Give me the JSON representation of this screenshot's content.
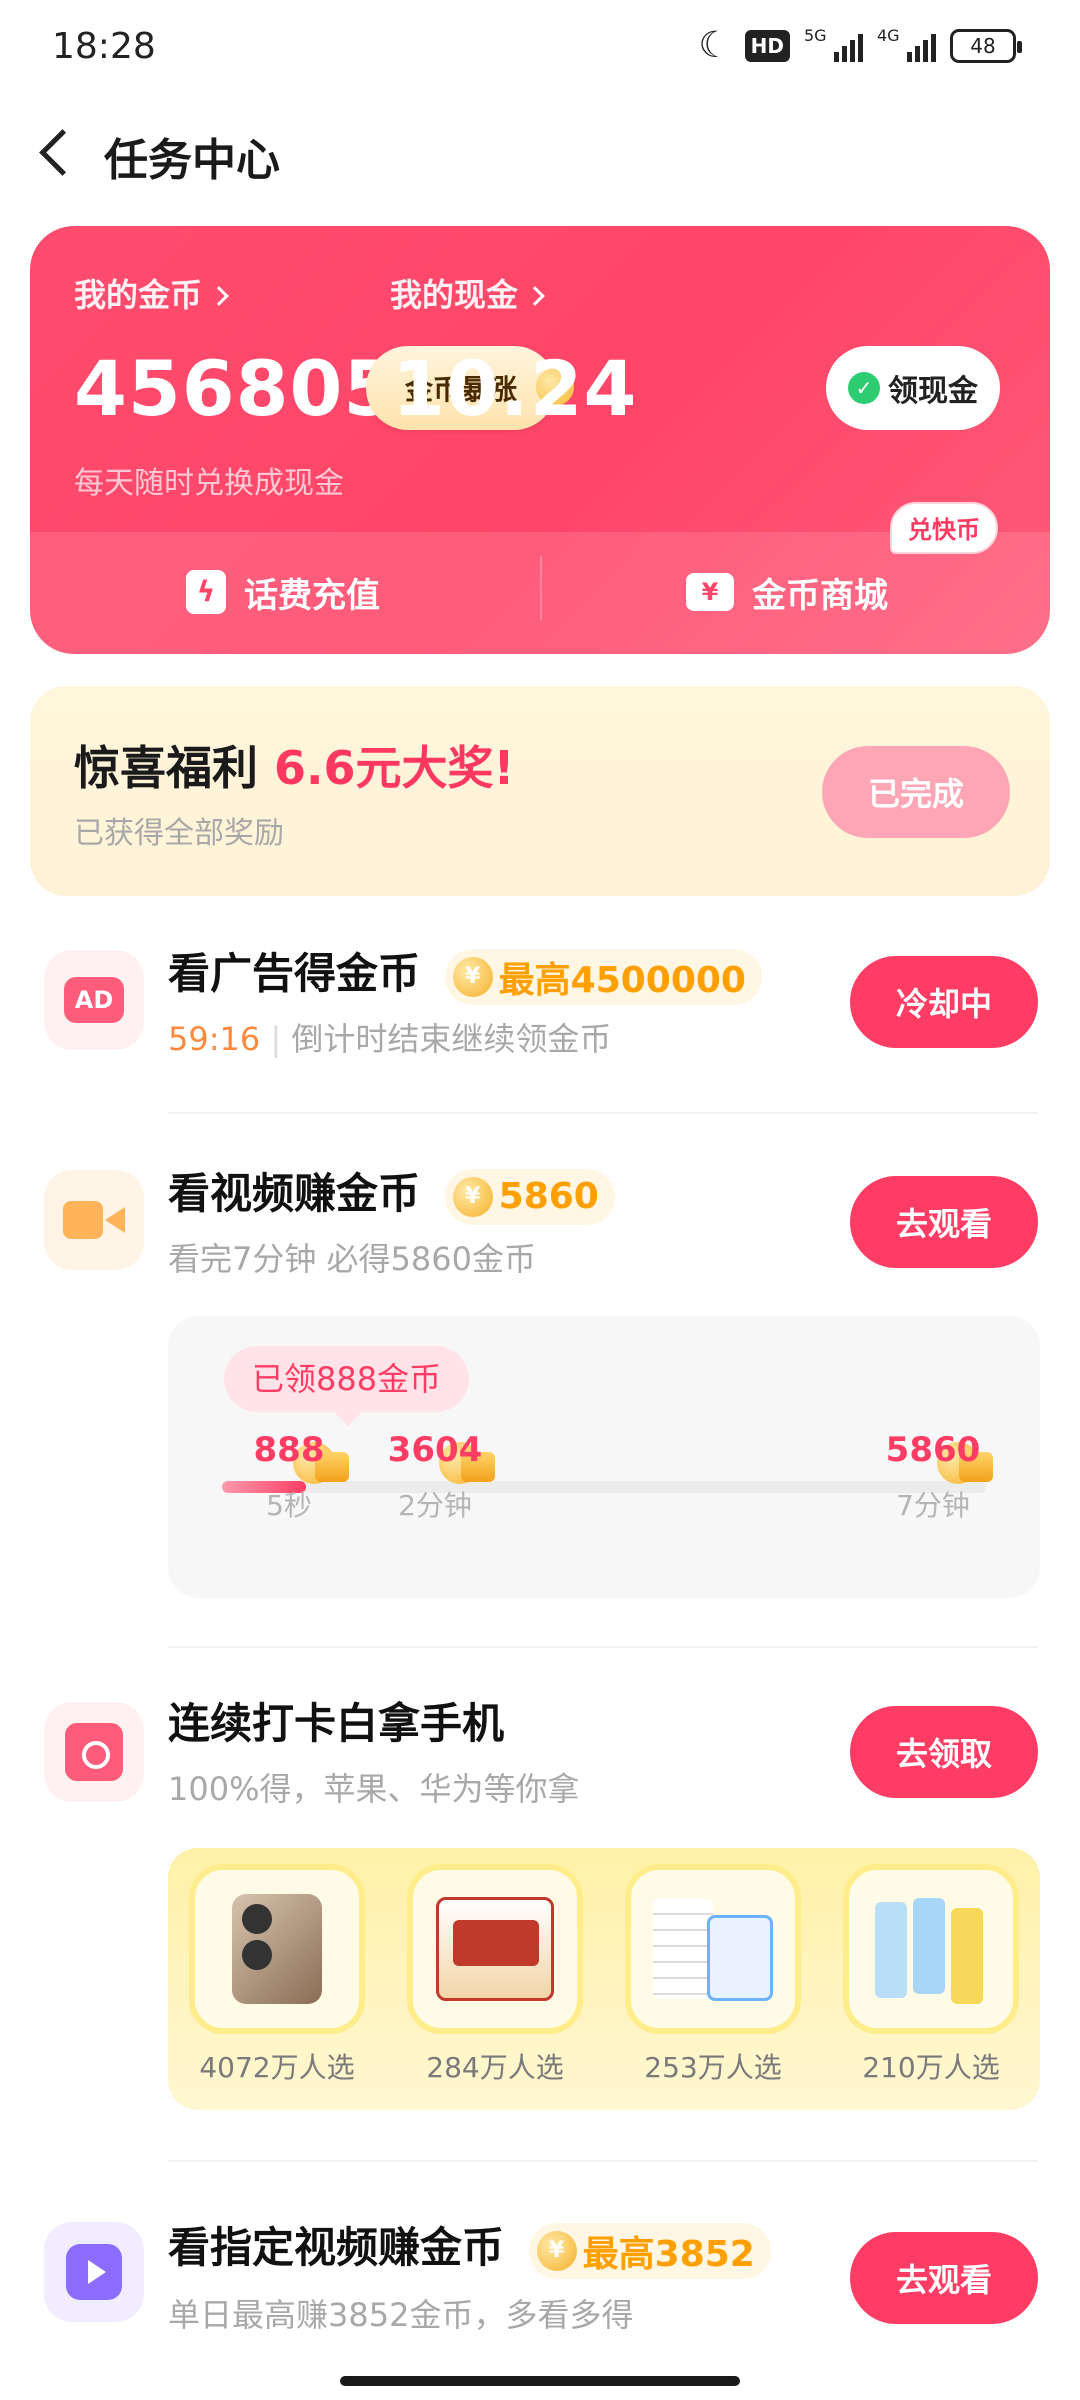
{
  "status_bar": {
    "time": "18:28",
    "hd": "HD",
    "sim1": "5G",
    "sim2": "4G",
    "battery": "48"
  },
  "header": {
    "title": "任务中心"
  },
  "wallet": {
    "coins_label": "我的金币",
    "coins_value": "456805",
    "coins_button": "金币暴涨",
    "cash_label": "我的现金",
    "cash_value": "10.24",
    "cash_button": "领现金",
    "subtitle": "每天随时兑换成现金",
    "action_recharge": "话费充值",
    "action_mall": "金币商城",
    "mall_tag": "兑快币"
  },
  "surprise": {
    "title": "惊喜福利",
    "title_highlight": "6.6元大奖!",
    "subtitle": "已获得全部奖励",
    "button": "已完成"
  },
  "tasks": {
    "ad": {
      "icon_text": "AD",
      "title": "看广告得金币",
      "reward": "最高4500000",
      "countdown": "59:16",
      "desc": "倒计时结束继续领金币",
      "button": "冷却中"
    },
    "video": {
      "title": "看视频赚金币",
      "reward": "5860",
      "desc": "看完7分钟 必得5860金币",
      "button": "去观看",
      "progress": {
        "claimed": "已领888金币",
        "fill_fraction": 0.11,
        "stops": [
          {
            "value": "888",
            "time": "5秒"
          },
          {
            "value": "3604",
            "time": "2分钟"
          },
          {
            "value": "5860",
            "time": "7分钟"
          }
        ]
      }
    },
    "checkin": {
      "title": "连续打卡白拿手机",
      "desc": "100%得，苹果、华为等你拿",
      "button": "去领取",
      "prizes": [
        {
          "count": "4072万人选",
          "icon": "phone"
        },
        {
          "count": "284万人选",
          "icon": "noodles"
        },
        {
          "count": "253万人选",
          "icon": "tissue"
        },
        {
          "count": "210万人选",
          "icon": "cosmetics"
        }
      ]
    },
    "specified": {
      "title": "看指定视频赚金币",
      "reward": "最高3852",
      "desc": "单日最高赚3852金币，多看多得",
      "button": "去观看"
    }
  },
  "colors": {
    "brand": "#ff3d64",
    "coin": "#ff9f00"
  }
}
